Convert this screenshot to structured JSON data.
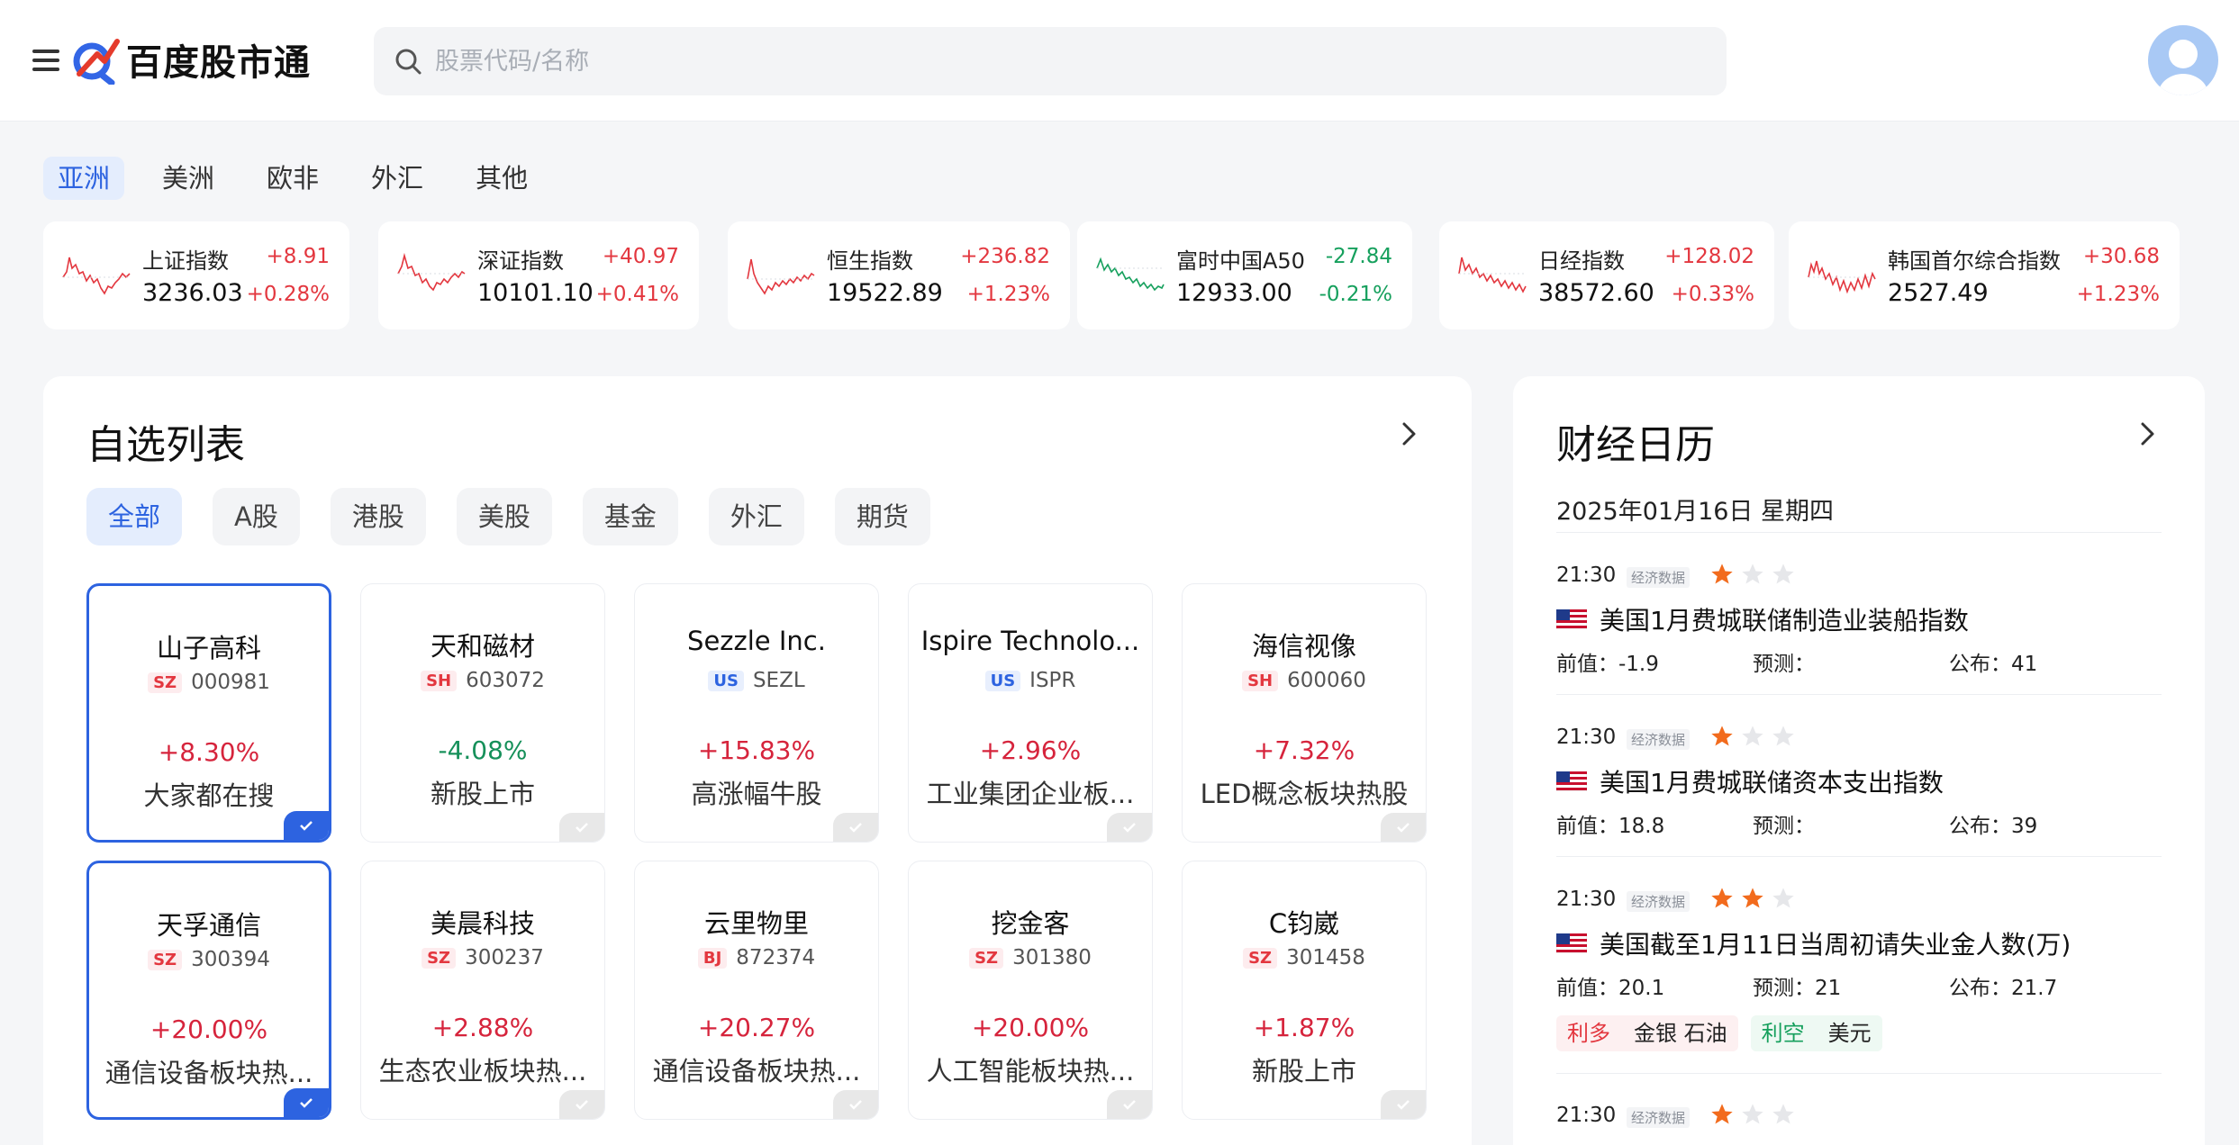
{
  "app": {
    "logo_text": "百度股市通"
  },
  "search": {
    "placeholder": "股票代码/名称"
  },
  "colors": {
    "accent": "#2d63e0",
    "up": "#e3373f",
    "down": "#16a05d"
  },
  "region_tabs": [
    {
      "label": "亚洲",
      "active": true
    },
    {
      "label": "美洲"
    },
    {
      "label": "欧非"
    },
    {
      "label": "外汇"
    },
    {
      "label": "其他"
    }
  ],
  "indices": [
    {
      "name": "上证指数",
      "price": "3236.03",
      "change": "+8.91",
      "pct": "+0.28%",
      "direction": "up"
    },
    {
      "name": "深证指数",
      "price": "10101.10",
      "change": "+40.97",
      "pct": "+0.41%",
      "direction": "up"
    },
    {
      "name": "恒生指数",
      "price": "19522.89",
      "change": "+236.82",
      "pct": "+1.23%",
      "direction": "up"
    },
    {
      "name": "富时中国A50",
      "price": "12933.00",
      "change": "-27.84",
      "pct": "-0.21%",
      "direction": "down"
    },
    {
      "name": "日经指数",
      "price": "38572.60",
      "change": "+128.02",
      "pct": "+0.33%",
      "direction": "up"
    },
    {
      "name": "韩国首尔综合指数",
      "price": "2527.49",
      "change": "+30.68",
      "pct": "+1.23%",
      "direction": "up"
    }
  ],
  "watchlist": {
    "title": "自选列表",
    "tabs": [
      {
        "label": "全部",
        "active": true
      },
      {
        "label": "A股"
      },
      {
        "label": "港股"
      },
      {
        "label": "美股"
      },
      {
        "label": "基金"
      },
      {
        "label": "外汇"
      },
      {
        "label": "期货"
      }
    ],
    "stocks": [
      {
        "name": "山子高科",
        "market": "SZ",
        "code": "000981",
        "pct": "+8.30%",
        "tag": "大家都在搜",
        "selected": true
      },
      {
        "name": "天和磁材",
        "market": "SH",
        "code": "603072",
        "pct": "-4.08%",
        "tag": "新股上市",
        "selected": false
      },
      {
        "name": "Sezzle Inc.",
        "market": "US",
        "code": "SEZL",
        "pct": "+15.83%",
        "tag": "高涨幅牛股",
        "selected": false
      },
      {
        "name": "Ispire Technolo...",
        "market": "US",
        "code": "ISPR",
        "pct": "+2.96%",
        "tag": "工业集团企业板...",
        "selected": false
      },
      {
        "name": "海信视像",
        "market": "SH",
        "code": "600060",
        "pct": "+7.32%",
        "tag": "LED概念板块热股",
        "selected": false
      },
      {
        "name": "天孚通信",
        "market": "SZ",
        "code": "300394",
        "pct": "+20.00%",
        "tag": "通信设备板块热...",
        "selected": true
      },
      {
        "name": "美晨科技",
        "market": "SZ",
        "code": "300237",
        "pct": "+2.88%",
        "tag": "生态农业板块热...",
        "selected": false
      },
      {
        "name": "云里物里",
        "market": "BJ",
        "code": "872374",
        "pct": "+20.27%",
        "tag": "通信设备板块热...",
        "selected": false
      },
      {
        "name": "挖金客",
        "market": "SZ",
        "code": "301380",
        "pct": "+20.00%",
        "tag": "人工智能板块热...",
        "selected": false
      },
      {
        "name": "C钧崴",
        "market": "SZ",
        "code": "301458",
        "pct": "+1.87%",
        "tag": "新股上市",
        "selected": false
      }
    ]
  },
  "calendar": {
    "title": "财经日历",
    "date": "2025年01月16日 星期四",
    "events": [
      {
        "time": "21:30",
        "badge": "经济数据",
        "stars": 1,
        "title": "美国1月费城联储制造业装船指数",
        "prev": "前值：-1.9",
        "forecast": "预测：",
        "actual": "公布：41"
      },
      {
        "time": "21:30",
        "badge": "经济数据",
        "stars": 1,
        "title": "美国1月费城联储资本支出指数",
        "prev": "前值：18.8",
        "forecast": "预测：",
        "actual": "公布：39"
      },
      {
        "time": "21:30",
        "badge": "经济数据",
        "stars": 2,
        "title": "美国截至1月11日当周初请失业金人数(万)",
        "prev": "前值：20.1",
        "forecast": "预测：21",
        "actual": "公布：21.7",
        "tags": [
          {
            "kind": "bull",
            "key": "利多",
            "value": "金银 石油"
          },
          {
            "kind": "bear",
            "key": "利空",
            "value": "美元"
          }
        ]
      },
      {
        "time": "21:30",
        "badge": "经济数据",
        "stars": 1
      }
    ]
  }
}
